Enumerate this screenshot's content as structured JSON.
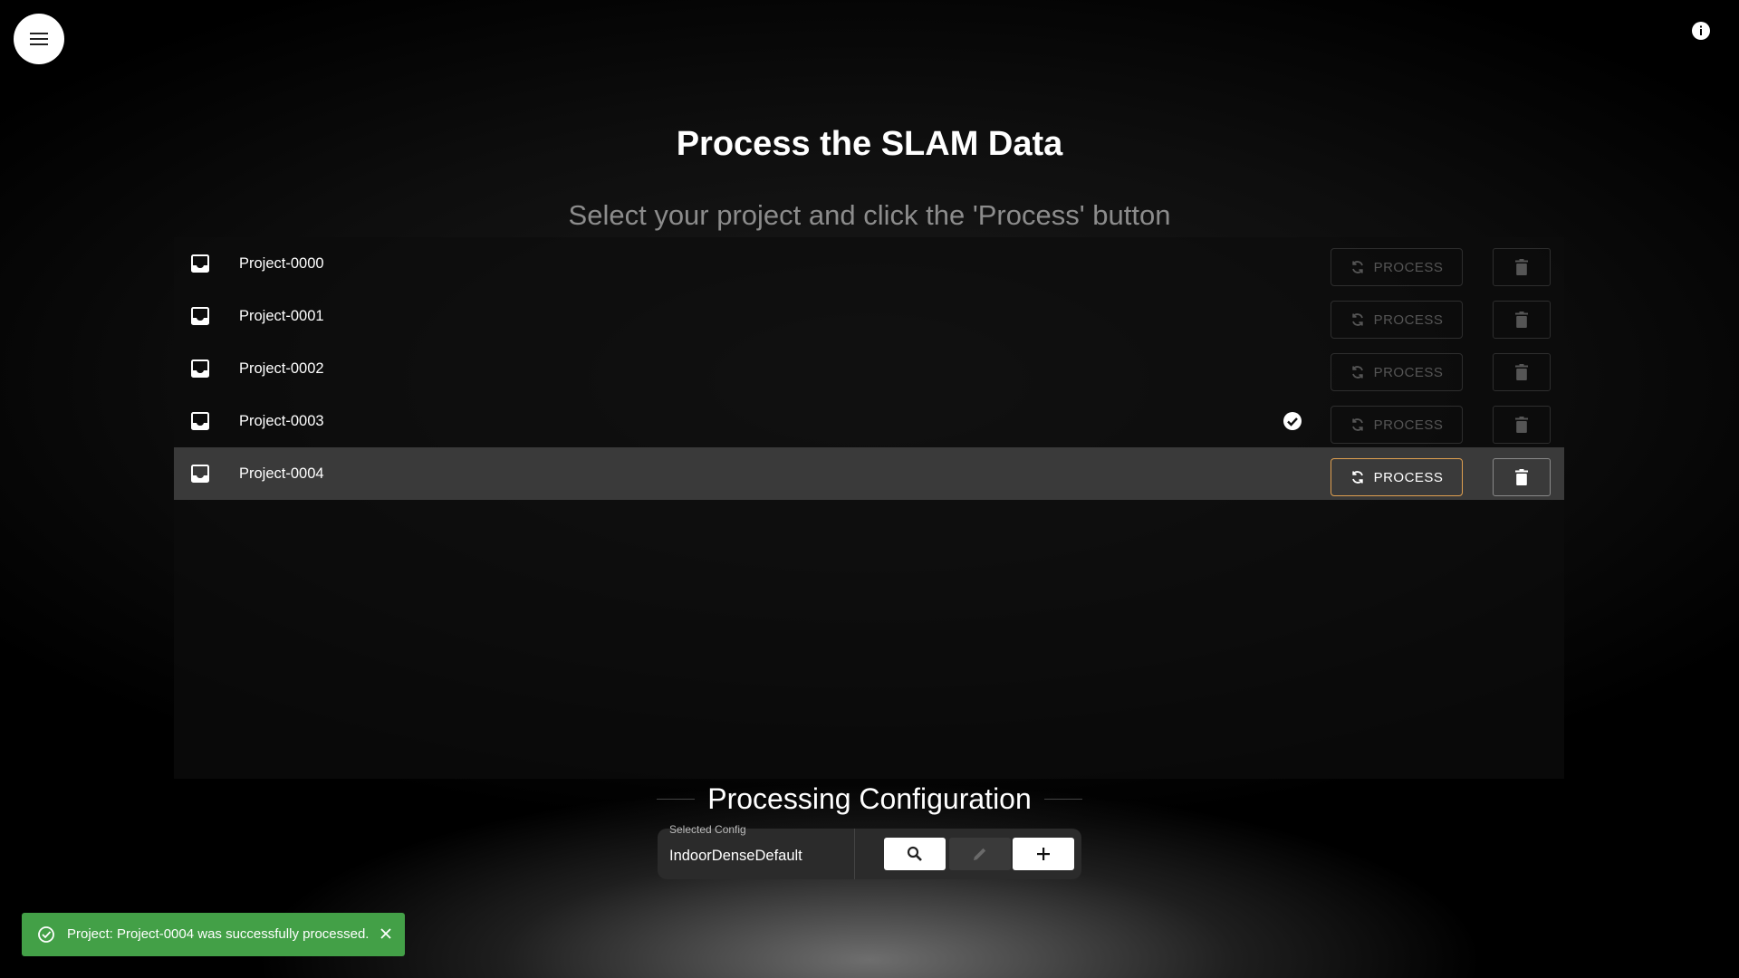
{
  "header": {
    "title": "Process the SLAM Data",
    "subtitle": "Select your project and click the 'Process' button"
  },
  "projects": [
    {
      "name": "Project-0000",
      "process_label": "PROCESS",
      "processed": false,
      "selected": false
    },
    {
      "name": "Project-0001",
      "process_label": "PROCESS",
      "processed": false,
      "selected": false
    },
    {
      "name": "Project-0002",
      "process_label": "PROCESS",
      "processed": false,
      "selected": false
    },
    {
      "name": "Project-0003",
      "process_label": "PROCESS",
      "processed": true,
      "selected": false
    },
    {
      "name": "Project-0004",
      "process_label": "PROCESS",
      "processed": false,
      "selected": true
    }
  ],
  "config": {
    "heading": "Processing Configuration",
    "field_label": "Selected Config",
    "field_value": "IndoorDenseDefault"
  },
  "toast": {
    "message": "Project: Project-0004 was successfully processed.",
    "color": "#43a047"
  },
  "colors": {
    "accent_border": "#e0a050",
    "selected_row": "#3a3a3a"
  },
  "icons": [
    "hamburger-menu-icon",
    "info-icon",
    "inbox-icon",
    "refresh-icon",
    "trash-icon",
    "check-circle-icon",
    "search-icon",
    "pencil-icon",
    "plus-icon",
    "success-icon",
    "close-icon"
  ]
}
